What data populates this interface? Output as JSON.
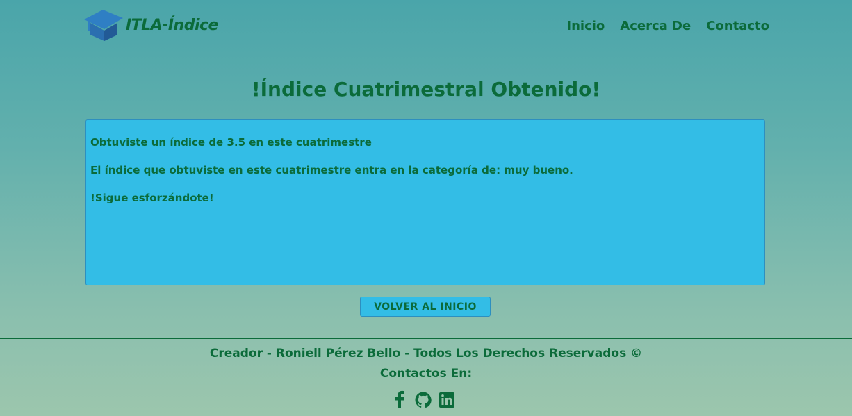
{
  "header": {
    "logo_text": "ITLA-Índice",
    "nav": [
      {
        "label": "Inicio"
      },
      {
        "label": "Acerca De"
      },
      {
        "label": "Contacto"
      }
    ]
  },
  "main": {
    "title": "!Índice Cuatrimestral Obtenido!",
    "result_lines": [
      "Obtuviste un índice de 3.5 en este cuatrimestre",
      "El índice que obtuviste en este cuatrimestre entra en la categoría de: muy bueno.",
      "!Sigue esforzándote!"
    ],
    "back_button": "VOLVER AL INICIO"
  },
  "footer": {
    "credits": "Creador - Roniell Pérez Bello - Todos Los Derechos Reservados ©",
    "contacts_label": "Contactos En:",
    "social_icons": [
      "facebook-icon",
      "github-icon",
      "linkedin-icon"
    ]
  },
  "colors": {
    "text": "#0b6b3a",
    "box": "#33bde6",
    "header_line": "#3c7fc3"
  }
}
